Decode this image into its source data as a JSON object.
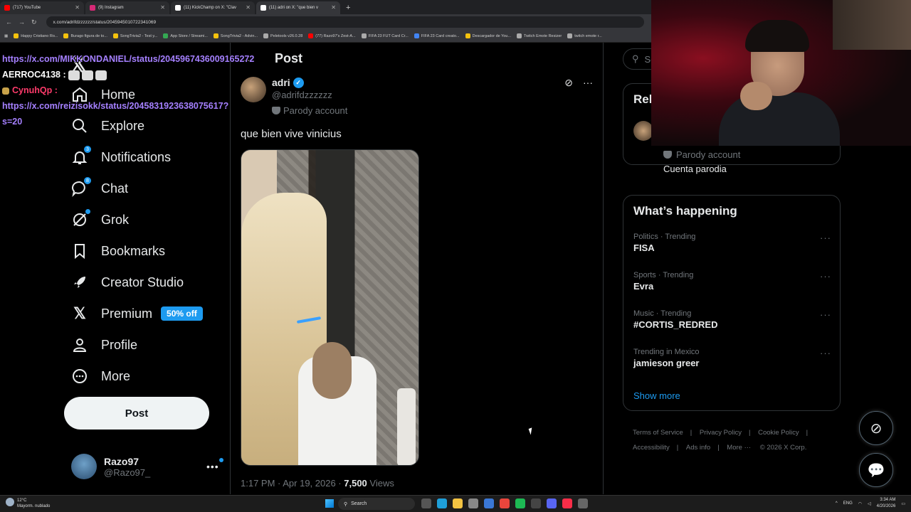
{
  "browser": {
    "tabs": [
      {
        "label": "(717) YouTube",
        "color": "#ff0000"
      },
      {
        "label": "(9) Instagram",
        "color": "#d62976"
      },
      {
        "label": "(11) KickChamp on X: \"Clav",
        "color": "#ffffff"
      },
      {
        "label": "(11) adri on X: \"que bien v",
        "color": "#ffffff"
      }
    ],
    "new_tab": "+",
    "url": "x.com/adrifdzzzzzz/status/2045945010722341069",
    "bookmarks": [
      {
        "label": "Happy Cristiano Ro...",
        "color": "#f4c20d"
      },
      {
        "label": "Burago figura de to...",
        "color": "#f4c20d"
      },
      {
        "label": "SongTrivia2 - Test y...",
        "color": "#f4c20d"
      },
      {
        "label": "App Store / Streami...",
        "color": "#34a853"
      },
      {
        "label": "SongTrivia2 - Advin...",
        "color": "#f4c20d"
      },
      {
        "label": "Peletools v26.0.28",
        "color": "#aaaaaa"
      },
      {
        "label": "(77) Razo97's Zest-A...",
        "color": "#ff0000"
      },
      {
        "label": "FIFA 23 FUT Card Cr...",
        "color": "#aaaaaa"
      },
      {
        "label": "FIFA 23 Card creato...",
        "color": "#4285f4"
      },
      {
        "label": "Descargador de You...",
        "color": "#f4c20d"
      },
      {
        "label": "Twitch Emote Resizer",
        "color": "#aaaaaa"
      },
      {
        "label": "twitch emote r...",
        "color": "#aaaaaa"
      }
    ]
  },
  "chat_overlay": {
    "link1": "https://x.com/MIKKONDANIEL/status/2045967436009165272",
    "user1": "AERROC4138 :",
    "user2": "CynuhQp :",
    "link2": "https://x.com/reizisokk/status/2045831923638075617?s=20"
  },
  "nav": {
    "home": "Home",
    "explore": "Explore",
    "notifications": "Notifications",
    "notifications_badge": "3",
    "chat": "Chat",
    "chat_badge": "8",
    "grok": "Grok",
    "bookmarks": "Bookmarks",
    "creator_studio": "Creator Studio",
    "premium": "Premium",
    "premium_pill": "50% off",
    "profile": "Profile",
    "more": "More",
    "post_button": "Post",
    "account_name": "Razo97",
    "account_handle": "@Razo97_"
  },
  "main": {
    "title": "Post",
    "author_name": "adri",
    "author_handle": "@adrifdzzzzzz",
    "parody_label": "Parody account",
    "text": "que bien vive vinicius",
    "time": "1:17 PM · Apr 19, 2026 · ",
    "views_count": "7,500",
    "views_label": " Views"
  },
  "right": {
    "search_placeholder": "Se",
    "relevant_title": "Rel",
    "relevant_parody": "Parody account",
    "relevant_desc": "Cuenta parodia",
    "happening_title": "What’s happening",
    "trends": [
      {
        "category": "Politics · Trending",
        "name": "FISA"
      },
      {
        "category": "Sports · Trending",
        "name": "Evra"
      },
      {
        "category": "Music · Trending",
        "name": "#CORTIS_REDRED"
      },
      {
        "category": "Trending in Mexico",
        "name": "jamieson greer"
      }
    ],
    "show_more": "Show more",
    "footer": [
      "Terms of Service",
      "Privacy Policy",
      "Cookie Policy",
      "Accessibility",
      "Ads info",
      "More ···",
      "© 2026 X Corp."
    ]
  },
  "taskbar": {
    "temp": "12°C",
    "weather": "Mayorm. nublado",
    "search": "Search",
    "lang": "ENG",
    "time": "3:34 AM",
    "date": "4/20/2026"
  },
  "colors": {
    "accent": "#1d9bf0",
    "bg": "#000000",
    "muted": "#71767b"
  }
}
